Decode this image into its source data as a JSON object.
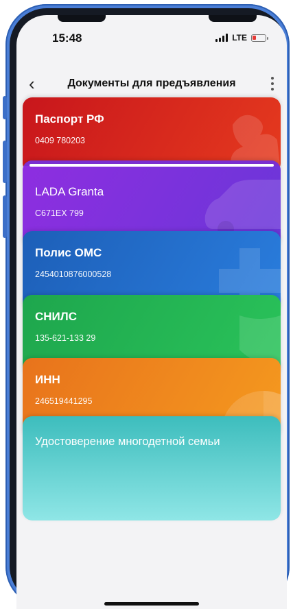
{
  "status_bar": {
    "time": "15:48",
    "network": "LTE"
  },
  "nav": {
    "back_icon": "chevron-left-icon",
    "title": "Документы для предъявления",
    "more_icon": "more-vertical-icon"
  },
  "cards": [
    {
      "title": "Паспорт РФ",
      "number": "0409 780203",
      "color_from": "#c8161c",
      "color_to": "#e53a1e"
    },
    {
      "title": "LADA Granta",
      "number": "С671ЕХ 799",
      "color_from": "#8e2ee0",
      "color_to": "#6a36d8"
    },
    {
      "title": "Полис ОМС",
      "number": "2454010876000528",
      "color_from": "#1d5fb8",
      "color_to": "#2a7ddd"
    },
    {
      "title": "СНИЛС",
      "number": "135-621-133 29",
      "color_from": "#1ea64d",
      "color_to": "#2ac35a"
    },
    {
      "title": "ИНН",
      "number": "246519441295",
      "color_from": "#e8731c",
      "color_to": "#f59a1f"
    },
    {
      "title": "Удостоверение многодетной семьи",
      "number": "",
      "color_from": "#3dbdbd",
      "color_to": "#8fe6e6"
    }
  ]
}
